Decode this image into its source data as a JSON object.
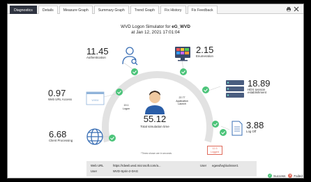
{
  "tabs": [
    {
      "label": "Diagnostics",
      "active": true
    },
    {
      "label": "Details",
      "active": false
    },
    {
      "label": "Measure Graph",
      "active": false
    },
    {
      "label": "Summary Graph",
      "active": false
    },
    {
      "label": "Trend Graph",
      "active": false
    },
    {
      "label": "Fix History",
      "active": false
    },
    {
      "label": "Fix Feedback",
      "active": false
    }
  ],
  "title": {
    "prefix": "WVD Logon Simulator for ",
    "name": "eG_WVD",
    "timestamp": "at Jan 12, 2021 17:01:04"
  },
  "metrics": {
    "authentication": {
      "value": "11.45",
      "label": "Authentication"
    },
    "enumeration": {
      "value": "2.15",
      "label": "Enumeration"
    },
    "web_url_access": {
      "value": "0.97",
      "label": "Web URL Access"
    },
    "hdx_session": {
      "value": "18.89",
      "label": "HDX session establishment"
    },
    "client_processing": {
      "value": "6.68",
      "label": "Client Processing"
    },
    "log_off": {
      "value": "3.88",
      "label": "Log Off"
    }
  },
  "inner": {
    "logon_value": "19.1",
    "logon_label": "Logon",
    "app_launch_value": "22.77",
    "app_launch_label": "Application Launch",
    "logged_value": "12.3",
    "logged_label": "Logged"
  },
  "total": {
    "value": "55.12",
    "label": "Total simulation time"
  },
  "note": "*Times shown are in seconds",
  "info": {
    "web_url_label": "Web URL",
    "web_url_value": "https://rdweb.wvd.microsoft.com/a...",
    "user_label_1": "User",
    "user_value_1": "WVD-Sprin-2-DAG",
    "user_label_2": "User",
    "user_value_2": "egwvd\\eg\\lucksser1"
  },
  "legend": {
    "success": "Success",
    "failed": "Failed"
  },
  "colors": {
    "success": "#4cc47a",
    "failed": "#e06a5a",
    "tab_active": "#2f3440",
    "arc": "#e2e2e2",
    "icon": "#3a6fb5"
  }
}
